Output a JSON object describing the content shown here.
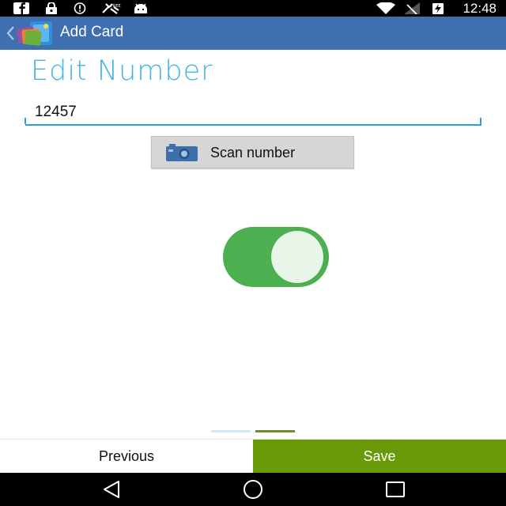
{
  "status_bar": {
    "time": "12:48",
    "icons": [
      "facebook-icon",
      "lock-icon",
      "info-icon",
      "satellite-icon",
      "android-icon",
      "wifi-icon",
      "signal-icon",
      "battery-charging-icon"
    ]
  },
  "action_bar": {
    "title": "Add Card",
    "color": "#3f6fae"
  },
  "content": {
    "page_title": "Edit Number",
    "number_value": "12457",
    "scan_button_label": "Scan number",
    "toggle_on": true,
    "accent_color": "#41b6e4",
    "toggle_color": "#4caf50"
  },
  "pager": {
    "total_pages": 2,
    "current_page": 2
  },
  "bottom_bar": {
    "previous_label": "Previous",
    "save_label": "Save",
    "save_color": "#6a9a0a"
  },
  "nav_bar": {
    "icons": [
      "back-icon",
      "home-icon",
      "recents-icon"
    ]
  }
}
